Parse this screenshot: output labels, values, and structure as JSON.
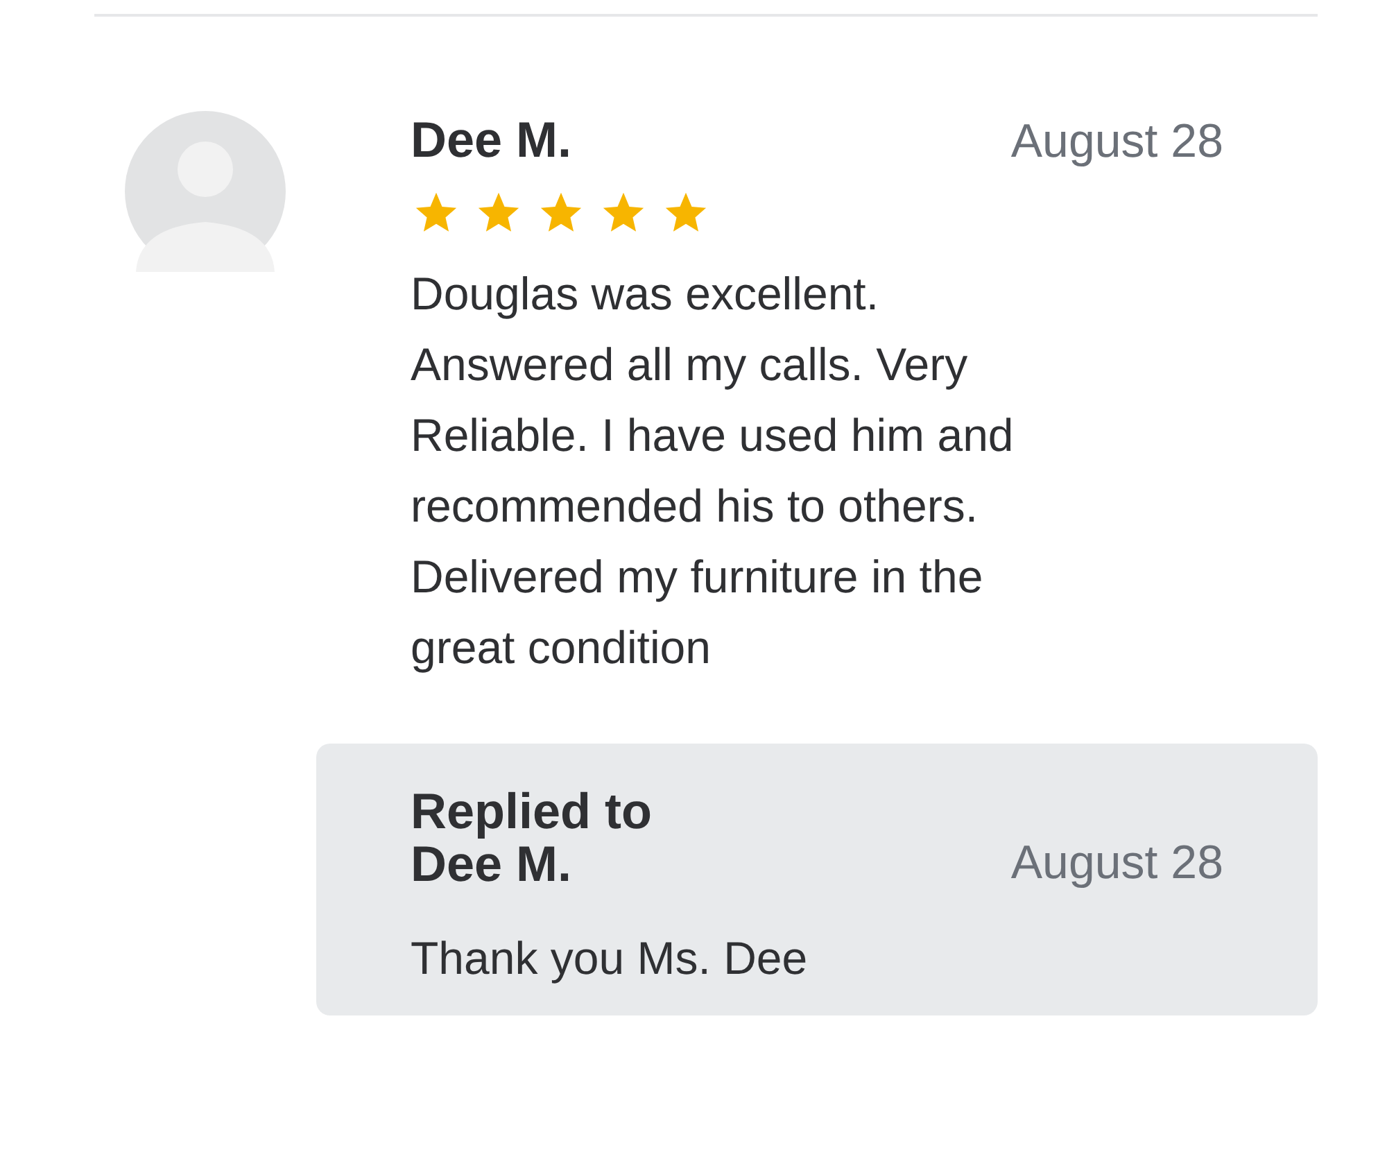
{
  "review": {
    "author": "Dee M.",
    "date": "August 28",
    "stars": 5,
    "text": "Douglas was excellent. Answered all my calls. Very Reliable. I have used him and recommended his to others. Delivered my furniture in the great condition"
  },
  "reply": {
    "title": "Replied to Dee M.",
    "date": "August 28",
    "text": "Thank you Ms. Dee"
  }
}
